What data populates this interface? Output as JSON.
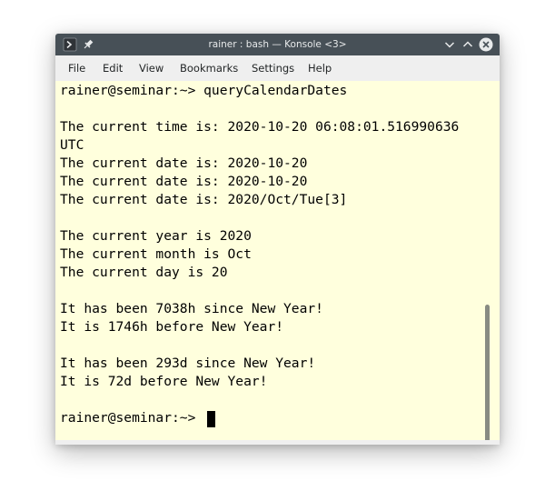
{
  "window": {
    "title": "rainer : bash — Konsole <3>"
  },
  "menu": {
    "items": [
      {
        "label": "File"
      },
      {
        "label": "Edit"
      },
      {
        "label": "View"
      },
      {
        "label": "Bookmarks"
      },
      {
        "label": "Settings"
      },
      {
        "label": "Help"
      }
    ]
  },
  "terminal": {
    "lines": [
      "rainer@seminar:~> queryCalendarDates",
      "",
      "The current time is: 2020-10-20 06:08:01.516990636",
      "UTC",
      "The current date is: 2020-10-20",
      "The current date is: 2020-10-20",
      "The current date is: 2020/Oct/Tue[3]",
      "",
      "The current year is 2020",
      "The current month is Oct",
      "The current day is 20",
      "",
      "It has been 7038h since New Year!",
      "It is 1746h before New Year!",
      "",
      "It has been 293d since New Year!",
      "It is 72d before New Year!",
      "",
      "rainer@seminar:~> "
    ]
  },
  "icons": {
    "app": "konsole-app-icon",
    "pin": "pin-icon",
    "minimize": "chevron-down-icon",
    "maximize": "chevron-up-icon",
    "close": "close-icon"
  },
  "colors": {
    "titlebar": "#475057",
    "terminal_background": "#ffffdd",
    "terminal_text": "#000000",
    "menubar": "#efefef"
  }
}
